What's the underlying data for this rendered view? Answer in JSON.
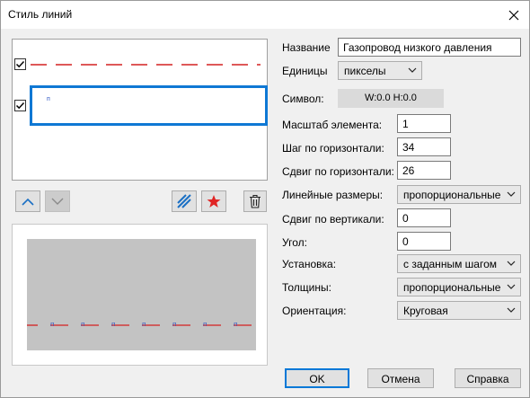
{
  "window": {
    "title": "Стиль линий"
  },
  "list": {
    "rows": [
      {
        "checked": true,
        "line_color": "#d42020"
      },
      {
        "checked": true,
        "marker": "п",
        "marker_color": "#2e55c4"
      }
    ]
  },
  "form": {
    "name_label": "Название",
    "name_value": "Газопровод низкого давления",
    "units_label": "Единицы",
    "units_value": "пикселы",
    "symbol_label": "Символ:",
    "symbol_value": "W:0.0  H:0.0",
    "scale_label": "Масштаб элемента:",
    "scale_value": "1",
    "hstep_label": "Шаг по горизонтали:",
    "hstep_value": "34",
    "hshift_label": "Сдвиг по горизонтали:",
    "hshift_value": "26",
    "linear_label": "Линейные размеры:",
    "linear_value": "пропорциональные",
    "vshift_label": "Сдвиг по вертикали:",
    "vshift_value": "0",
    "angle_label": "Угол:",
    "angle_value": "0",
    "placement_label": "Установка:",
    "placement_value": "с заданным шагом",
    "thickness_label": "Толщины:",
    "thickness_value": "пропорциональные",
    "orientation_label": "Ориентация:",
    "orientation_value": "Круговая"
  },
  "buttons": {
    "ok": "OK",
    "cancel": "Отмена",
    "help": "Справка"
  },
  "preview": {
    "marker": "п",
    "line_color": "#d42020",
    "marker_color": "#2e55c4"
  }
}
